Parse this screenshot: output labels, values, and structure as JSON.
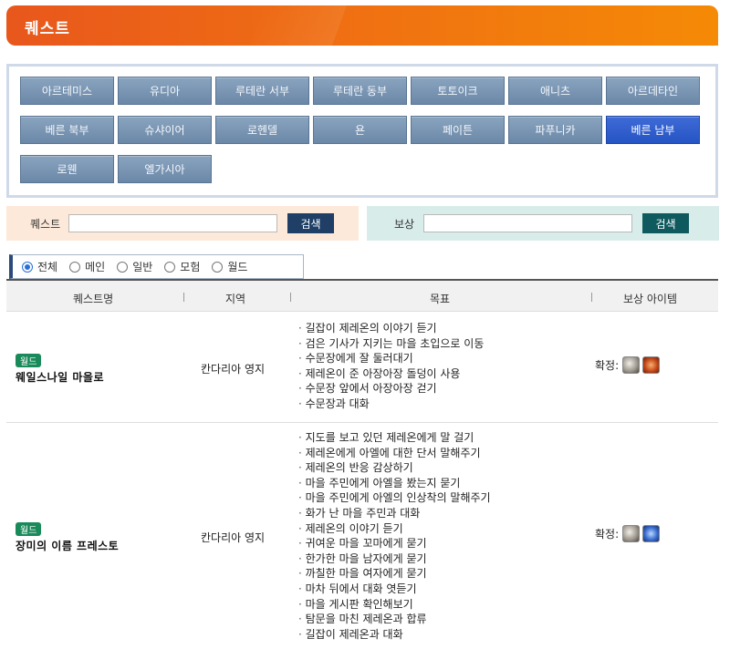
{
  "header": {
    "title": "퀘스트"
  },
  "regions": [
    [
      "아르테미스",
      "유디아",
      "루테란 서부",
      "루테란 동부",
      "토토이크",
      "애니츠",
      "아르데타인"
    ],
    [
      "베른 북부",
      "슈샤이어",
      "로헨델",
      "욘",
      "페이튼",
      "파푸니카",
      "베른 남부"
    ],
    [
      "로웬",
      "엘가시아"
    ]
  ],
  "active_region": "베른 남부",
  "search": {
    "quest_label": "퀘스트",
    "quest_value": "",
    "quest_button": "검색",
    "reward_label": "보상",
    "reward_value": "",
    "reward_button": "검색"
  },
  "filters": [
    {
      "label": "전체",
      "checked": true
    },
    {
      "label": "메인",
      "checked": false
    },
    {
      "label": "일반",
      "checked": false
    },
    {
      "label": "모험",
      "checked": false
    },
    {
      "label": "월드",
      "checked": false
    }
  ],
  "table": {
    "headers": {
      "name": "퀘스트명",
      "region": "지역",
      "goal": "목표",
      "reward": "보상 아이템"
    },
    "rows": [
      {
        "badge": "월드",
        "name": "웨일스나일 마을로",
        "region": "칸다리아 영지",
        "goals": [
          "길잡이 제레온의 이야기 듣기",
          "검은 기사가 지키는 마을 초입으로 이동",
          "수문장에게 잘 둘러대기",
          "제레온이 준 아장아장 돌덩이 사용",
          "수문장 앞에서 아장아장 걷기",
          "수문장과 대화"
        ],
        "reward_label": "확정:",
        "reward_icons": [
          "stone-item-icon",
          "fire-item-icon"
        ]
      },
      {
        "badge": "월드",
        "name": "장미의 이름 프레스토",
        "region": "칸다리아 영지",
        "goals": [
          "지도를 보고 있던 제레온에게 말 걸기",
          "제레온에게 아엘에 대한 단서 말해주기",
          "제레온의 반응 감상하기",
          "마을 주민에게 아엘을 봤는지 묻기",
          "마을 주민에게 아엘의 인상착의 말해주기",
          "화가 난 마을 주민과 대화",
          "제레온의 이야기 듣기",
          "귀여운 마을 꼬마에게 묻기",
          "한가한 마을 남자에게 묻기",
          "까칠한 마을 여자에게 묻기",
          "마차 뒤에서 대화 엿듣기",
          "마을 게시판 확인해보기",
          "탐문을 마친 제레온과 합류",
          "길잡이 제레온과 대화"
        ],
        "reward_label": "확정:",
        "reward_icons": [
          "stone-item-icon",
          "blue-item-icon"
        ]
      }
    ]
  }
}
